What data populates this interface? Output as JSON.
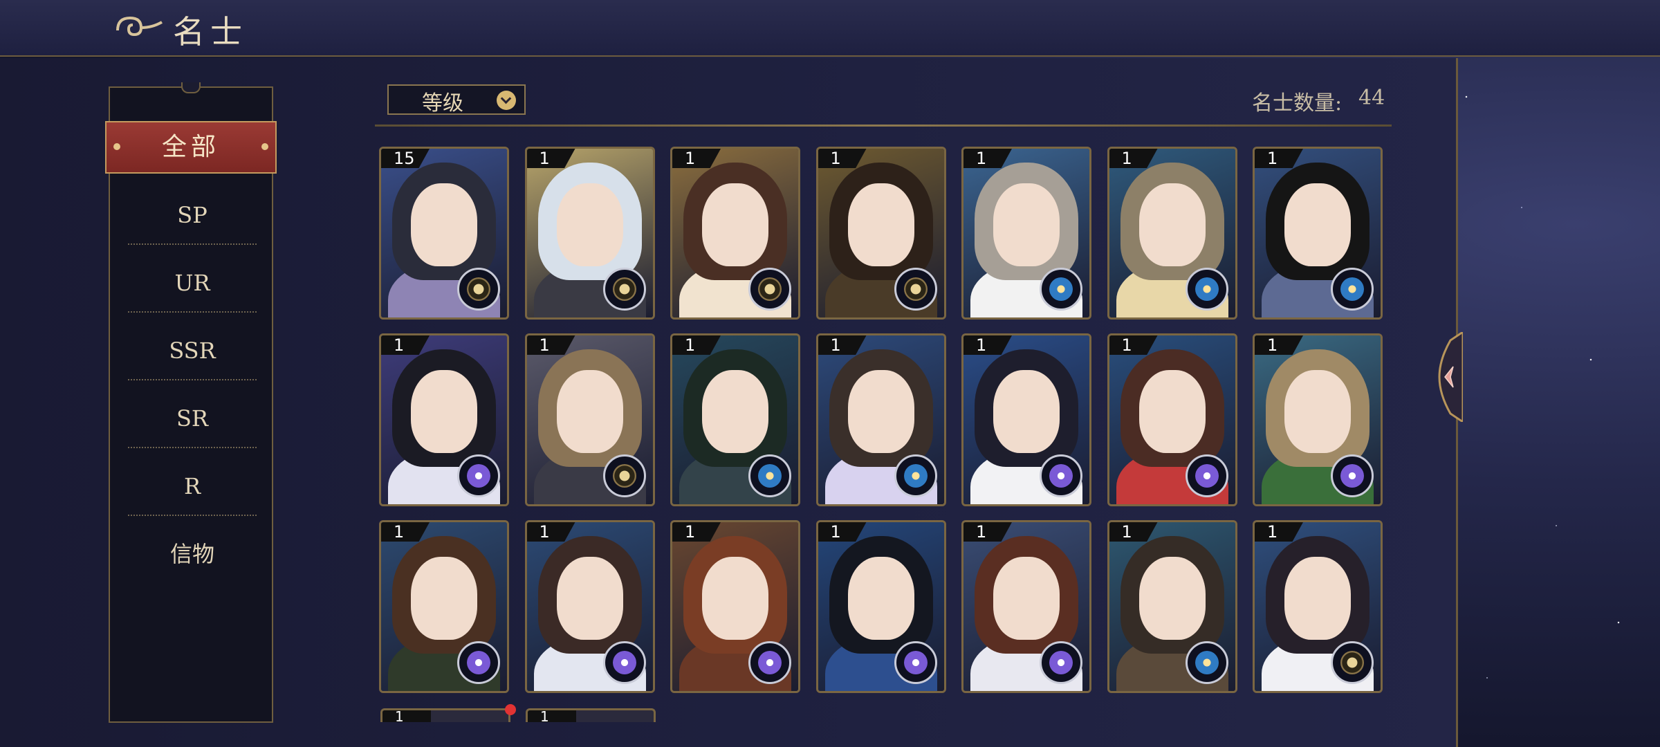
{
  "header": {
    "title": "名士"
  },
  "sidebar": {
    "items": [
      {
        "label": "全部",
        "active": true
      },
      {
        "label": "SP"
      },
      {
        "label": "UR"
      },
      {
        "label": "SSR"
      },
      {
        "label": "SR"
      },
      {
        "label": "R"
      },
      {
        "label": "信物"
      }
    ]
  },
  "toolbar": {
    "sort_label": "等级",
    "count_label": "名士数量:",
    "count_value": "44"
  },
  "cards": [
    {
      "level": "15",
      "emblem": "gold"
    },
    {
      "level": "1",
      "emblem": "gold"
    },
    {
      "level": "1",
      "emblem": "gold"
    },
    {
      "level": "1",
      "emblem": "gold"
    },
    {
      "level": "1",
      "emblem": "blue"
    },
    {
      "level": "1",
      "emblem": "blue"
    },
    {
      "level": "1",
      "emblem": "blue"
    },
    {
      "level": "1",
      "emblem": "purple"
    },
    {
      "level": "1",
      "emblem": "gold"
    },
    {
      "level": "1",
      "emblem": "blue"
    },
    {
      "level": "1",
      "emblem": "blue"
    },
    {
      "level": "1",
      "emblem": "purple"
    },
    {
      "level": "1",
      "emblem": "purple"
    },
    {
      "level": "1",
      "emblem": "purple"
    },
    {
      "level": "1",
      "emblem": "purple"
    },
    {
      "level": "1",
      "emblem": "purple"
    },
    {
      "level": "1",
      "emblem": "purple"
    },
    {
      "level": "1",
      "emblem": "purple"
    },
    {
      "level": "1",
      "emblem": "purple"
    },
    {
      "level": "1",
      "emblem": "blue"
    },
    {
      "level": "1",
      "emblem": "gold"
    }
  ],
  "partial_cards": [
    {
      "level": "1"
    },
    {
      "level": "1"
    }
  ],
  "colors": {
    "accent_gold": "#c49a5e",
    "active_red": "#9a3a34",
    "notification": "#e23333"
  }
}
